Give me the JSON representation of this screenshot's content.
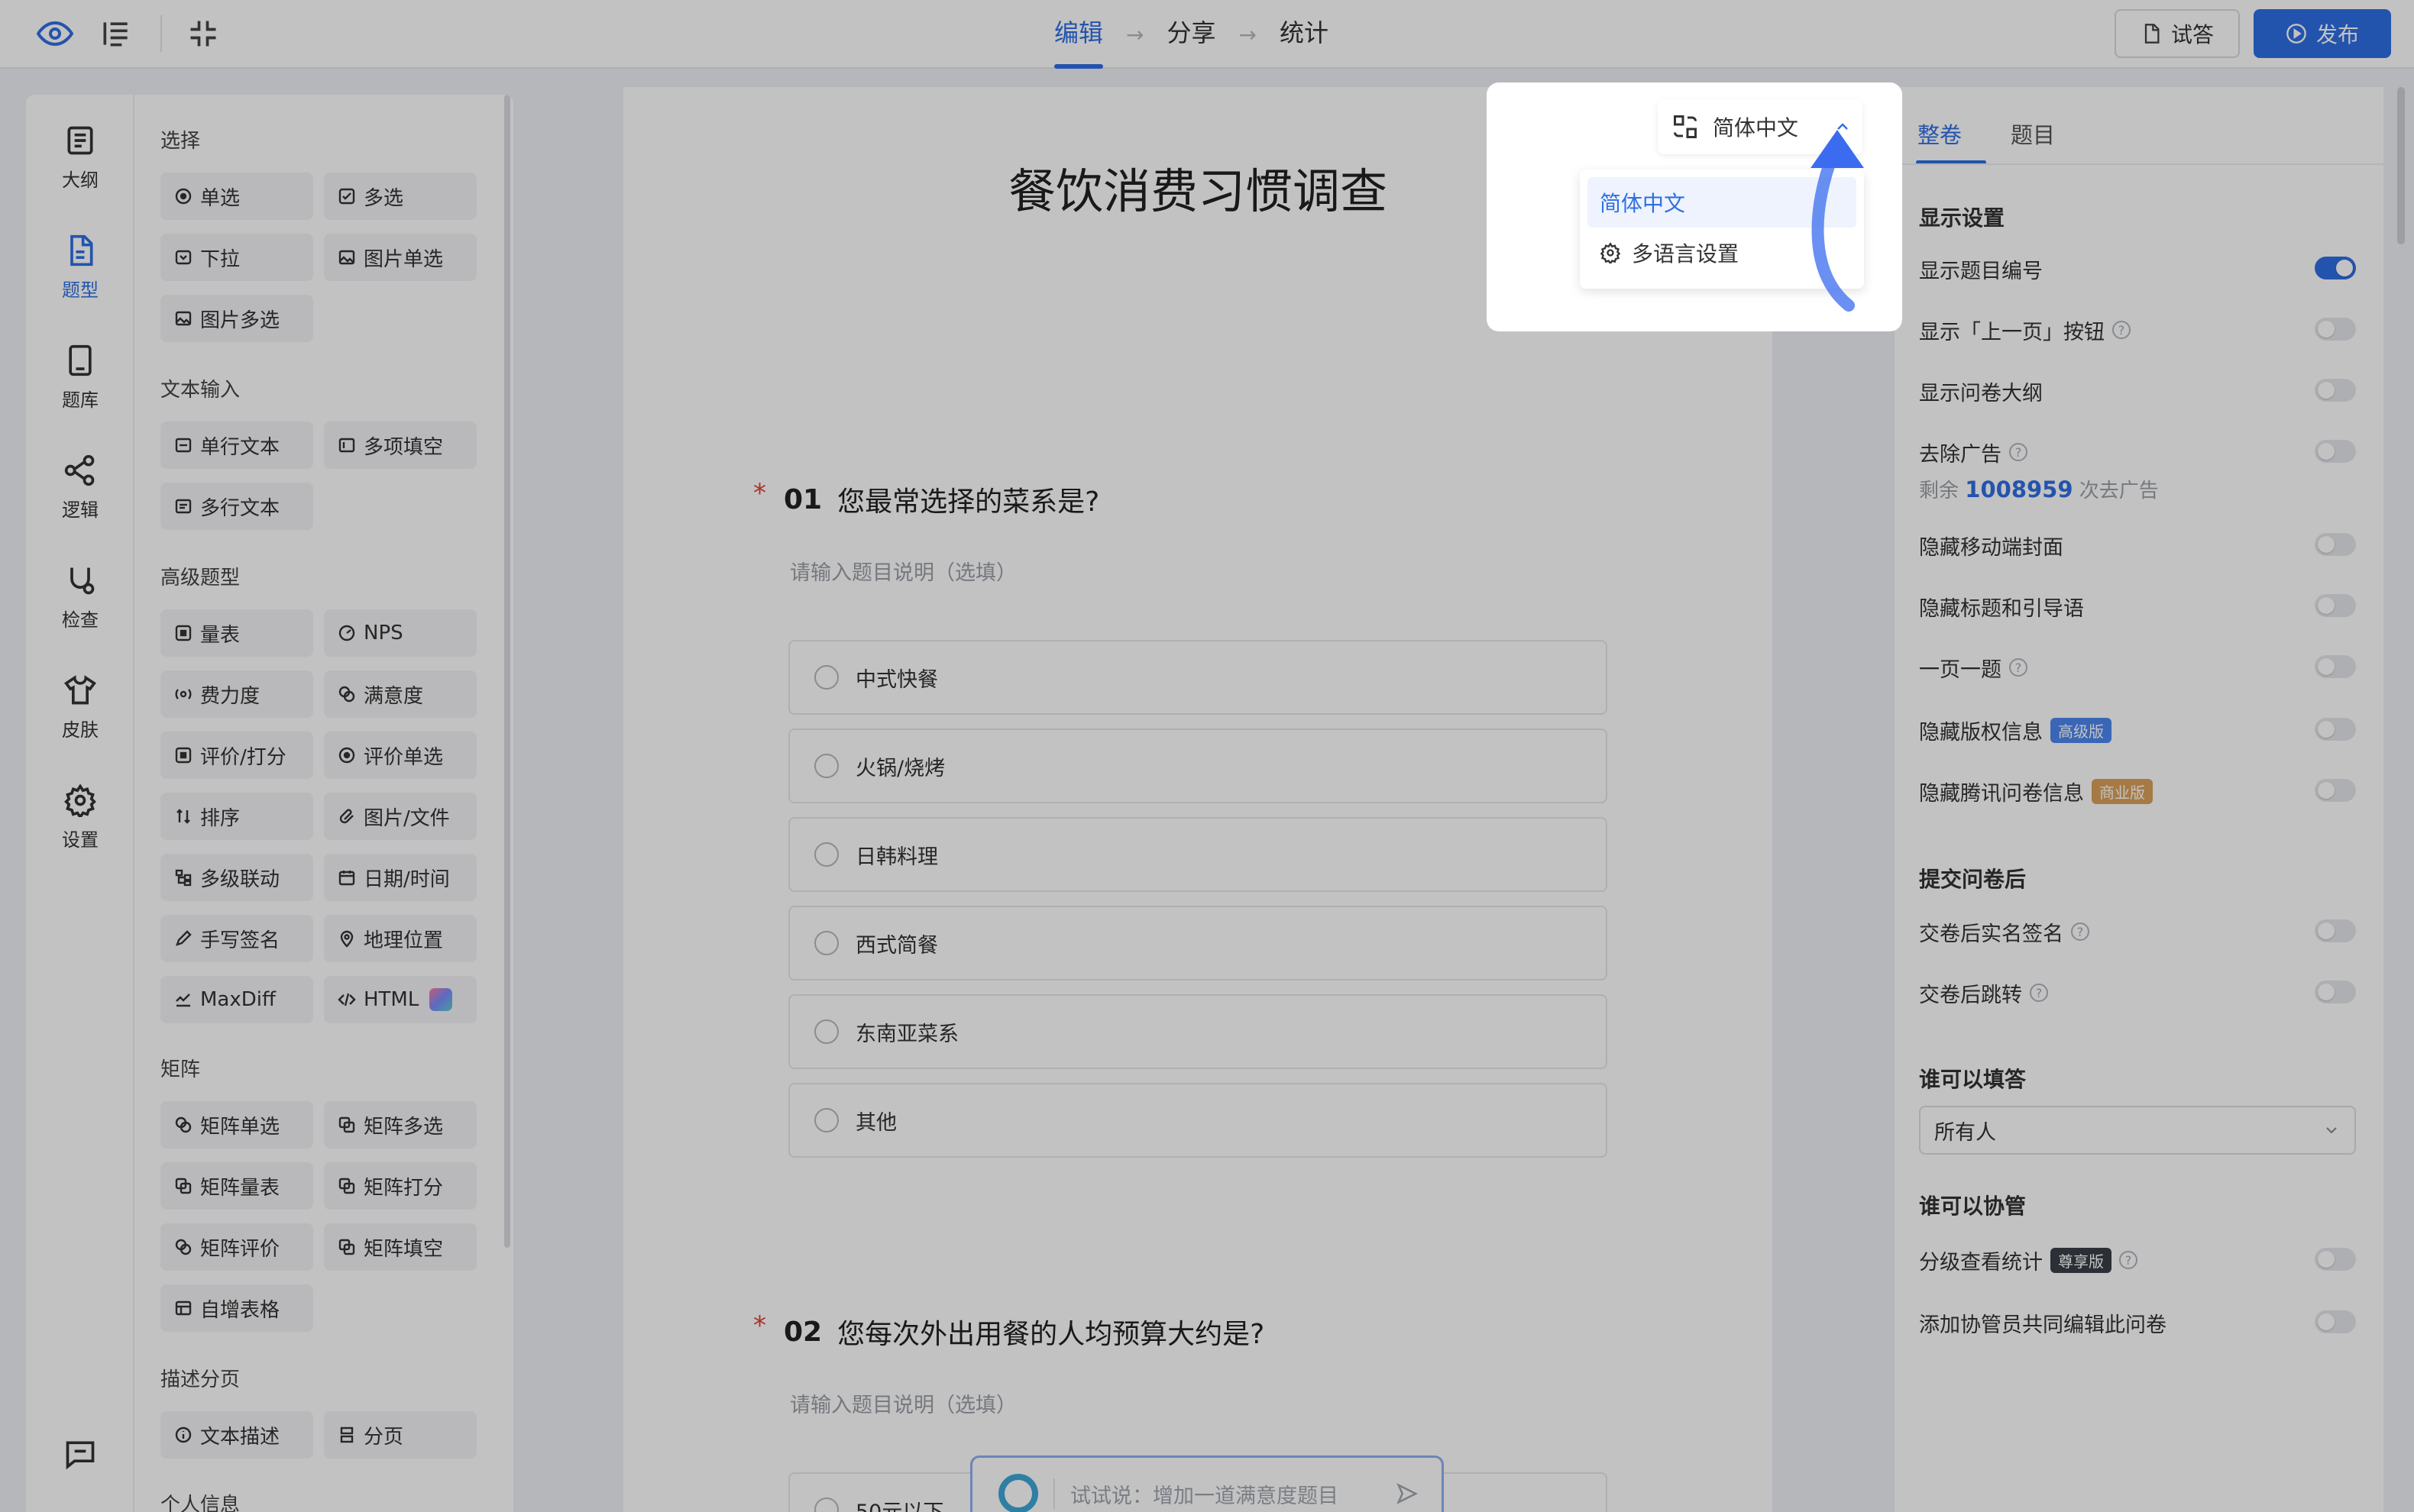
{
  "topbar": {
    "steps": [
      "编辑",
      "分享",
      "统计"
    ],
    "try_label": "试答",
    "publish_label": "发布"
  },
  "rail": {
    "items": [
      {
        "label": "大纲",
        "icon": "outline-icon"
      },
      {
        "label": "题型",
        "icon": "question-type-icon"
      },
      {
        "label": "题库",
        "icon": "question-bank-icon"
      },
      {
        "label": "逻辑",
        "icon": "logic-icon"
      },
      {
        "label": "检查",
        "icon": "check-icon"
      },
      {
        "label": "皮肤",
        "icon": "skin-icon"
      },
      {
        "label": "设置",
        "icon": "settings-icon"
      }
    ]
  },
  "palette": {
    "sections": [
      {
        "title": "选择",
        "items": [
          "单选",
          "多选",
          "下拉",
          "图片单选",
          "图片多选"
        ]
      },
      {
        "title": "文本输入",
        "items": [
          "单行文本",
          "多项填空",
          "多行文本"
        ]
      },
      {
        "title": "高级题型",
        "items": [
          "量表",
          "NPS",
          "费力度",
          "满意度",
          "评价/打分",
          "评价单选",
          "排序",
          "图片/文件",
          "多级联动",
          "日期/时间",
          "手写签名",
          "地理位置",
          "MaxDiff",
          "HTML"
        ]
      },
      {
        "title": "矩阵",
        "items": [
          "矩阵单选",
          "矩阵多选",
          "矩阵量表",
          "矩阵打分",
          "矩阵评价",
          "矩阵填空",
          "自增表格"
        ]
      },
      {
        "title": "描述分页",
        "items": [
          "文本描述",
          "分页"
        ]
      },
      {
        "title": "个人信息",
        "items": []
      }
    ]
  },
  "survey": {
    "title": "餐饮消费习惯调查",
    "questions": [
      {
        "number": "01",
        "title": "您最常选择的菜系是?",
        "desc_placeholder": "请输入题目说明（选填）",
        "options": [
          "中式快餐",
          "火锅/烧烤",
          "日韩料理",
          "西式简餐",
          "东南亚菜系",
          "其他"
        ]
      },
      {
        "number": "02",
        "title": "您每次外出用餐的人均预算大约是?",
        "desc_placeholder": "请输入题目说明（选填）",
        "options": [
          "50元以下"
        ]
      }
    ],
    "ai_placeholder": "试试说：增加一道满意度题目"
  },
  "language": {
    "current": "简体中文",
    "menu": [
      "简体中文",
      "多语言设置"
    ]
  },
  "right_panel": {
    "tabs": [
      "整卷",
      "题目"
    ],
    "display_title": "显示设置",
    "rows": [
      {
        "label": "显示题目编号",
        "on": true
      },
      {
        "label": "显示「上一页」按钮",
        "on": false
      },
      {
        "label": "显示问卷大纲",
        "on": false
      },
      {
        "label": "去除广告",
        "on": false
      },
      {
        "label": "隐藏移动端封面",
        "on": false
      },
      {
        "label": "隐藏标题和引导语",
        "on": false
      },
      {
        "label": "一页一题",
        "on": false
      },
      {
        "label": "隐藏版权信息",
        "on": false
      },
      {
        "label": "隐藏腾讯问卷信息",
        "on": false
      }
    ],
    "ad_remaining_prefix": "剩余",
    "ad_remaining_count": "1008959",
    "ad_remaining_suffix": "次去广告",
    "badge_advanced": "高级版",
    "badge_business": "商业版",
    "submit_title": "提交问卷后",
    "submit_rows": [
      {
        "label": "交卷后实名签名",
        "on": false
      },
      {
        "label": "交卷后跳转",
        "on": false
      }
    ],
    "who_fill_title": "谁可以填答",
    "who_fill_value": "所有人",
    "collab_title": "谁可以协管",
    "collab_rows": [
      {
        "label": "分级查看统计",
        "on": false
      },
      {
        "label": "添加协管员共同编辑此问卷",
        "on": false
      }
    ],
    "badge_premium": "尊享版"
  },
  "colors": {
    "accent": "#2f6fe4",
    "required": "#e0423a"
  }
}
